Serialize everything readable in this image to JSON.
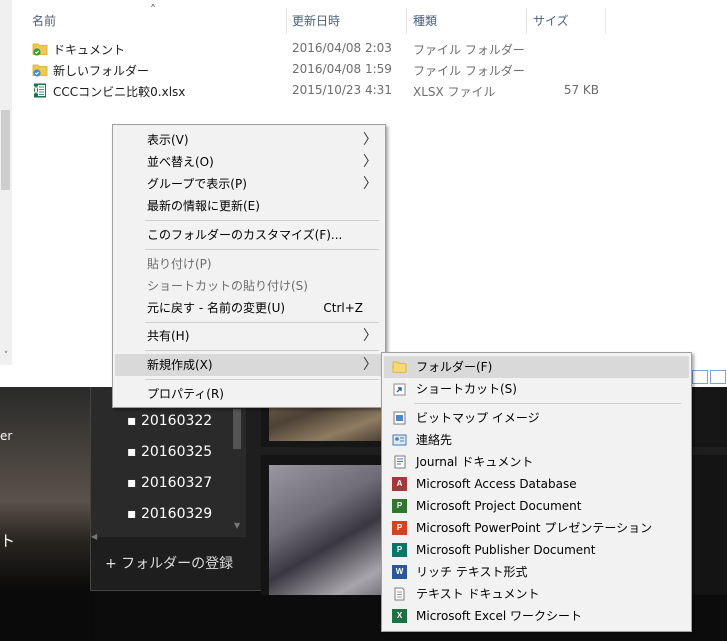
{
  "explorer": {
    "columns": {
      "name": "名前",
      "modified": "更新日時",
      "type": "種類",
      "size": "サイズ"
    },
    "files": [
      {
        "name": "ドキュメント",
        "modified": "2016/04/08 2:03",
        "type": "ファイル フォルダー",
        "size": ""
      },
      {
        "name": "新しいフォルダー",
        "modified": "2016/04/08 1:59",
        "type": "ファイル フォルダー",
        "size": ""
      },
      {
        "name": "CCCコンビニ比較0.xlsx",
        "modified": "2015/10/23 4:31",
        "type": "XLSX ファイル",
        "size": "57 KB"
      }
    ]
  },
  "context_menu": {
    "view": "表示(V)",
    "sort_by": "並べ替え(O)",
    "group_by": "グループで表示(P)",
    "refresh": "最新の情報に更新(E)",
    "customize": "このフォルダーのカスタマイズ(F)...",
    "paste": "貼り付け(P)",
    "paste_shortcut": "ショートカットの貼り付け(S)",
    "undo": "元に戻す - 名前の変更(U)",
    "undo_shortcut": "Ctrl+Z",
    "share": "共有(H)",
    "new": "新規作成(X)",
    "properties": "プロパティ(R)"
  },
  "new_submenu": {
    "items": [
      {
        "label": "フォルダー(F)",
        "icon": "folder-icon"
      },
      {
        "label": "ショートカット(S)",
        "icon": "shortcut-icon"
      },
      {
        "label": "ビットマップ イメージ",
        "icon": "bitmap-icon"
      },
      {
        "label": "連絡先",
        "icon": "contact-icon"
      },
      {
        "label": "Journal ドキュメント",
        "icon": "journal-icon"
      },
      {
        "label": "Microsoft Access Database",
        "icon": "access-icon"
      },
      {
        "label": "Microsoft Project Document",
        "icon": "project-icon"
      },
      {
        "label": "Microsoft PowerPoint プレゼンテーション",
        "icon": "powerpoint-icon"
      },
      {
        "label": "Microsoft Publisher Document",
        "icon": "publisher-icon"
      },
      {
        "label": "リッチ テキスト形式",
        "icon": "word-icon"
      },
      {
        "label": "テキスト ドキュメント",
        "icon": "text-document-icon"
      },
      {
        "label": "Microsoft Excel ワークシート",
        "icon": "excel-icon"
      }
    ]
  },
  "photos_app": {
    "dates": [
      "20160322",
      "20160325",
      "20160327",
      "20160329"
    ],
    "add_folder": "+ フォルダーの登録",
    "left_text_1": "er",
    "left_text_2": "ト"
  },
  "colors": {
    "menu_bg": "#f2f2f2",
    "menu_highlight": "#d9d9d9",
    "folder_yellow": "#f3c94c",
    "excel_green": "#1e7145",
    "access_red": "#a4373a",
    "powerpoint_orange": "#d04423",
    "publisher_teal": "#077568",
    "word_blue": "#2b579a",
    "project_green": "#31752f"
  }
}
